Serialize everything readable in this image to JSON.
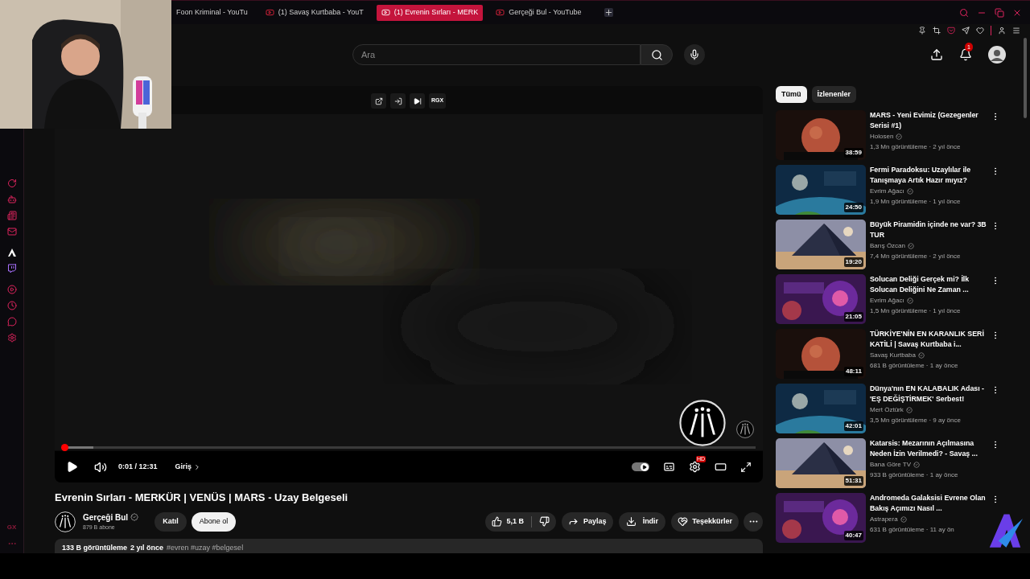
{
  "tabs": [
    {
      "title": "Foon Kriminal - YouTu",
      "selected": false
    },
    {
      "title": "(1) Savaş Kurtbaba - YouT",
      "selected": false
    },
    {
      "title": "(1) Evrenin Sırları - MERK",
      "selected": true
    },
    {
      "title": "Gerçeği Bul - YouTube",
      "selected": false
    }
  ],
  "sidebar": {
    "footer": "GX"
  },
  "search": {
    "placeholder": "Ara"
  },
  "notifications": {
    "badge": "1"
  },
  "player": {
    "overlay_label": "RGX",
    "progress": {
      "level": 0.003
    },
    "time": "0:01 / 12:31",
    "chapter": "Giriş",
    "autoplay": {
      "on": true
    },
    "quality_badge": "HD"
  },
  "video": {
    "title": "Evrenin Sırları - MERKÜR | VENÜS | MARS - Uzay Belgeseli",
    "channel": "Gerçeği Bul",
    "subscribers": "879 B abone",
    "join": "Katıl",
    "subscribe": "Abone ol",
    "likes": "5,1 B",
    "share": "Paylaş",
    "download": "İndir",
    "thanks": "Teşekkürler",
    "views": "133 B görüntüleme",
    "age": "2 yıl önce",
    "tags": "#evren #uzay #belgesel"
  },
  "filters": [
    {
      "label": "Tümü",
      "selected": true
    },
    {
      "label": "İzlenenler",
      "selected": false
    }
  ],
  "recommendations": [
    {
      "title": "MARS - Yeni Evimiz (Gezegenler Serisi #1)",
      "channel": "Holosen",
      "meta": "1,3 Mn görüntüleme · 2 yıl önce",
      "duration": "38:59"
    },
    {
      "title": "Fermi Paradoksu: Uzaylılar ile Tanışmaya Artık Hazır mıyız?",
      "channel": "Evrim Ağacı",
      "meta": "1,9 Mn görüntüleme · 1 yıl önce",
      "duration": "24:50"
    },
    {
      "title": "Büyük Piramidin içinde ne var? 3B TUR",
      "channel": "Barış Özcan",
      "meta": "7,4 Mn görüntüleme · 2 yıl önce",
      "duration": "19:20"
    },
    {
      "title": "Solucan Deliği Gerçek mi? İlk Solucan Deliğini Ne Zaman ...",
      "channel": "Evrim Ağacı",
      "meta": "1,5 Mn görüntüleme · 1 yıl önce",
      "duration": "21:05"
    },
    {
      "title": "TÜRKİYE'NİN EN KARANLIK SERİ KATİLİ | Savaş Kurtbaba i...",
      "channel": "Savaş Kurtbaba",
      "meta": "681 B görüntüleme · 1 ay önce",
      "duration": "48:11"
    },
    {
      "title": "Dünya'nın EN KALABALIK Adası - 'EŞ DEĞİŞTİRMEK' Serbest!",
      "channel": "Mert Öztürk",
      "meta": "3,5 Mn görüntüleme · 9 ay önce",
      "duration": "42:01"
    },
    {
      "title": "Katarsis: Mezarının Açılmasına Neden İzin Verilmedi? - Savaş ...",
      "channel": "Bana Göre TV",
      "meta": "933 B görüntüleme · 1 ay önce",
      "duration": "51:31"
    },
    {
      "title": "Andromeda Galaksisi Evrene Olan Bakış Açımızı Nasıl ...",
      "channel": "Astrapera",
      "meta": "631 B görüntüleme · 11 ay ön",
      "duration": "40:47"
    }
  ]
}
